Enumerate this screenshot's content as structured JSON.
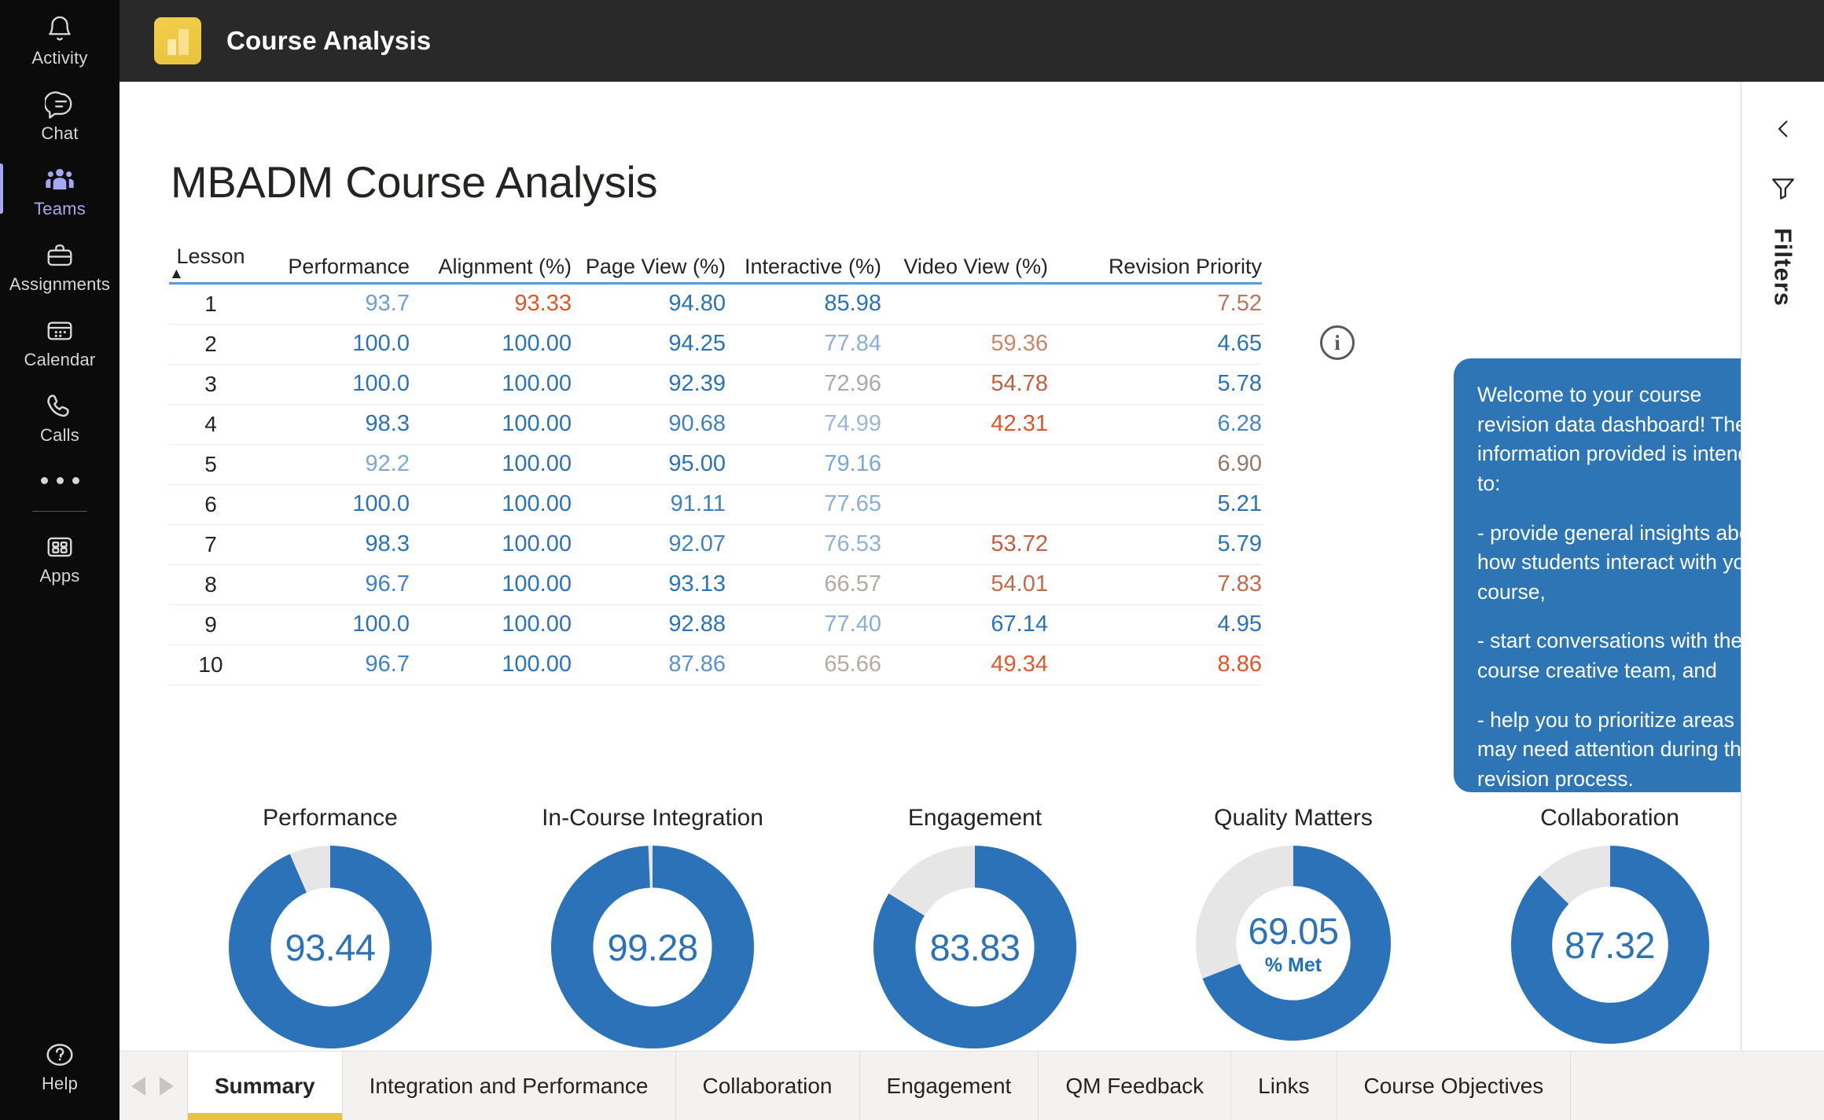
{
  "rail": {
    "items": [
      {
        "label": "Activity",
        "icon": "bell-icon",
        "active": false
      },
      {
        "label": "Chat",
        "icon": "chat-icon",
        "active": false
      },
      {
        "label": "Teams",
        "icon": "teams-icon",
        "active": true
      },
      {
        "label": "Assignments",
        "icon": "assignments-icon",
        "active": false
      },
      {
        "label": "Calendar",
        "icon": "calendar-icon",
        "active": false
      },
      {
        "label": "Calls",
        "icon": "calls-icon",
        "active": false
      }
    ],
    "more": "more-icon",
    "apps": {
      "label": "Apps",
      "icon": "apps-icon"
    },
    "help": {
      "label": "Help",
      "icon": "help-icon"
    }
  },
  "header": {
    "title": "Course Analysis",
    "icon": "power-bi-icon"
  },
  "report": {
    "title": "MBADM Course Analysis",
    "info_icon": "info-icon",
    "info_card": [
      "Welcome to your course revision data dashboard! The information provided is intended to:",
      "- provide general insights about how students interact with your course,",
      "- start conversations with the course creative team, and",
      "- help you to prioritize areas that may need attention during the revision process."
    ]
  },
  "chart_data": [
    {
      "type": "table",
      "title": "Lesson metrics table",
      "sort_column": "Lesson",
      "sort_direction": "ascending",
      "columns": [
        "Lesson",
        "Performance",
        "Alignment (%)",
        "Page View (%)",
        "Interactive (%)",
        "Video View (%)",
        "Revision Priority"
      ],
      "rows": [
        {
          "lesson": "1",
          "performance": "93.7",
          "alignment": "93.33",
          "page_view": "94.80",
          "interactive": "85.98",
          "video_view": "",
          "revision_priority": "7.52"
        },
        {
          "lesson": "2",
          "performance": "100.0",
          "alignment": "100.00",
          "page_view": "94.25",
          "interactive": "77.84",
          "video_view": "59.36",
          "revision_priority": "4.65"
        },
        {
          "lesson": "3",
          "performance": "100.0",
          "alignment": "100.00",
          "page_view": "92.39",
          "interactive": "72.96",
          "video_view": "54.78",
          "revision_priority": "5.78"
        },
        {
          "lesson": "4",
          "performance": "98.3",
          "alignment": "100.00",
          "page_view": "90.68",
          "interactive": "74.99",
          "video_view": "42.31",
          "revision_priority": "6.28"
        },
        {
          "lesson": "5",
          "performance": "92.2",
          "alignment": "100.00",
          "page_view": "95.00",
          "interactive": "79.16",
          "video_view": "",
          "revision_priority": "6.90"
        },
        {
          "lesson": "6",
          "performance": "100.0",
          "alignment": "100.00",
          "page_view": "91.11",
          "interactive": "77.65",
          "video_view": "",
          "revision_priority": "5.21"
        },
        {
          "lesson": "7",
          "performance": "98.3",
          "alignment": "100.00",
          "page_view": "92.07",
          "interactive": "76.53",
          "video_view": "53.72",
          "revision_priority": "5.79"
        },
        {
          "lesson": "8",
          "performance": "96.7",
          "alignment": "100.00",
          "page_view": "93.13",
          "interactive": "66.57",
          "video_view": "54.01",
          "revision_priority": "7.83"
        },
        {
          "lesson": "9",
          "performance": "100.0",
          "alignment": "100.00",
          "page_view": "92.88",
          "interactive": "77.40",
          "video_view": "67.14",
          "revision_priority": "4.95"
        },
        {
          "lesson": "10",
          "performance": "96.7",
          "alignment": "100.00",
          "page_view": "87.86",
          "interactive": "65.66",
          "video_view": "49.34",
          "revision_priority": "8.86"
        }
      ],
      "cell_colors": {
        "performance": [
          "#6f9fd0",
          "#2b72b8",
          "#2b72b8",
          "#2b72b8",
          "#7fa9d4",
          "#2b72b8",
          "#2b72b8",
          "#3f81c2",
          "#2b72b8",
          "#3f81c2"
        ],
        "alignment": [
          "#e0562a",
          "#2b72b8",
          "#2b72b8",
          "#2b72b8",
          "#2b72b8",
          "#2b72b8",
          "#2b72b8",
          "#2b72b8",
          "#2b72b8",
          "#2b72b8"
        ],
        "page_view": [
          "#2b72b8",
          "#2b72b8",
          "#2b72b8",
          "#3f81c2",
          "#2b72b8",
          "#3f81c2",
          "#3f81c2",
          "#2b72b8",
          "#2b72b8",
          "#5d91c9"
        ],
        "interactive": [
          "#2b72b8",
          "#8aaed6",
          "#a9a9a9",
          "#9cb6d6",
          "#7ba7d3",
          "#8aaed6",
          "#8fb1d8",
          "#b3a9a4",
          "#8aaed6",
          "#b5aba5"
        ],
        "video_view": [
          "",
          "#c9866b",
          "#c06040",
          "#e0562a",
          "",
          "",
          "#c06040",
          "#c06b4c",
          "#2b72b8",
          "#de5b2e"
        ],
        "revision_priority": [
          "#b07a63",
          "#2b72b8",
          "#2b72b8",
          "#4a86c4",
          "#8f7a6e",
          "#2b72b8",
          "#2b72b8",
          "#c06b4c",
          "#2b72b8",
          "#e0562a"
        ]
      }
    },
    {
      "type": "pie",
      "chart_kind": "donut-gauge",
      "title": "Performance",
      "value": 93.44,
      "display_value": "93.44",
      "max": 100,
      "fill_color": "#2b72b8",
      "track_color": "#e6e6e6"
    },
    {
      "type": "pie",
      "chart_kind": "donut-gauge",
      "title": "In-Course Integration",
      "value": 99.28,
      "display_value": "99.28",
      "max": 100,
      "fill_color": "#2b72b8",
      "track_color": "#e6e6e6"
    },
    {
      "type": "pie",
      "chart_kind": "donut-gauge",
      "title": "Engagement",
      "value": 83.83,
      "display_value": "83.83",
      "max": 100,
      "fill_color": "#2b72b8",
      "track_color": "#e6e6e6"
    },
    {
      "type": "pie",
      "chart_kind": "donut-gauge",
      "title": "Quality Matters",
      "value": 69.05,
      "display_value": "69.05",
      "sub_label": "% Met",
      "max": 100,
      "fill_color": "#2b72b8",
      "track_color": "#e6e6e6"
    },
    {
      "type": "pie",
      "chart_kind": "donut-gauge",
      "title": "Collaboration",
      "value": 87.32,
      "display_value": "87.32",
      "max": 100,
      "fill_color": "#2b72b8",
      "track_color": "#e6e6e6"
    }
  ],
  "filters": {
    "label": "Filters",
    "collapse_icon": "chevron-left-icon",
    "funnel_icon": "filter-funnel-icon"
  },
  "tabs": {
    "prev_icon": "caret-left-icon",
    "next_icon": "caret-right-icon",
    "items": [
      {
        "label": "Summary",
        "active": true
      },
      {
        "label": "Integration and Performance",
        "active": false
      },
      {
        "label": "Collaboration",
        "active": false
      },
      {
        "label": "Engagement",
        "active": false
      },
      {
        "label": "QM Feedback",
        "active": false
      },
      {
        "label": "Links",
        "active": false
      },
      {
        "label": "Course Objectives",
        "active": false
      }
    ]
  }
}
